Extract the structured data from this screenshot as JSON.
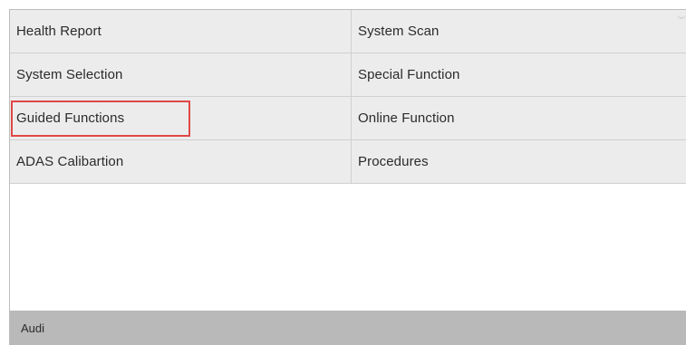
{
  "menu": {
    "items": [
      {
        "label": "Health Report"
      },
      {
        "label": "System Scan"
      },
      {
        "label": "System Selection"
      },
      {
        "label": "Special Function"
      },
      {
        "label": "Guided Functions",
        "highlighted": true
      },
      {
        "label": "Online Function"
      },
      {
        "label": "ADAS Calibartion"
      },
      {
        "label": "Procedures"
      }
    ],
    "highlight_color": "#e04848"
  },
  "footer": {
    "vehicle_label": "Audi"
  }
}
